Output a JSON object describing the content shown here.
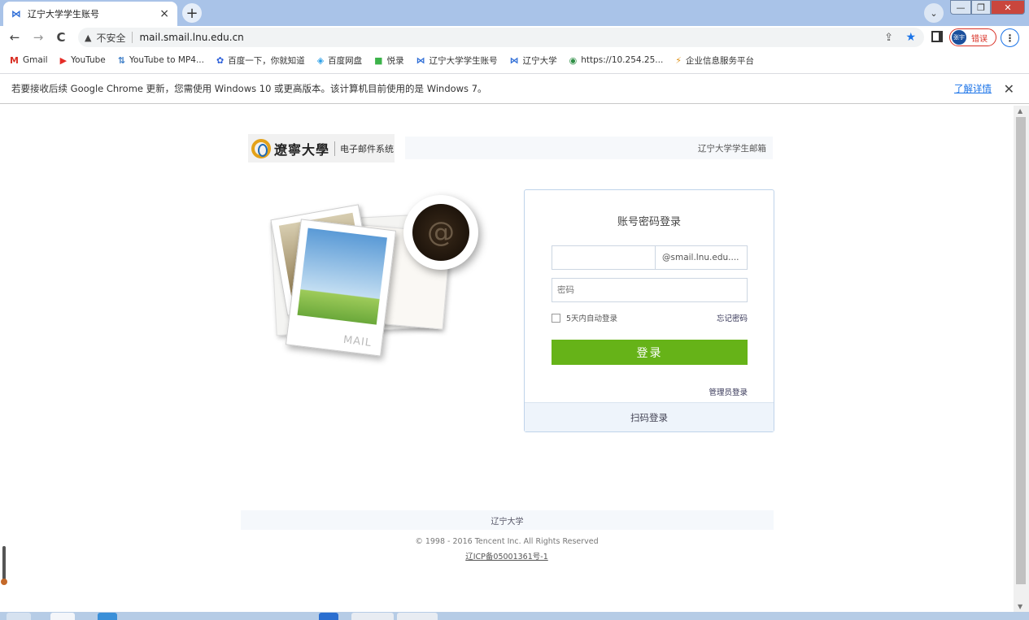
{
  "browser": {
    "tab_title": "辽宁大学学生账号",
    "tab_close": "×",
    "new_tab": "+",
    "tab_search": "⌄",
    "window_min": "—",
    "window_max": "❐",
    "window_close": "✕",
    "nav_back": "←",
    "nav_forward": "→",
    "nav_reload": "C",
    "security_label": "不安全",
    "url": "mail.smail.lnu.edu.cn",
    "profile_error": "错误",
    "profile_avatar": "张宇",
    "menu": "⋮"
  },
  "bookmarks": [
    {
      "icon": "gmail-icon",
      "glyph": "M",
      "color": "#d93025",
      "label": "Gmail"
    },
    {
      "icon": "youtube-icon",
      "glyph": "▶",
      "color": "#e52d27",
      "label": "YouTube"
    },
    {
      "icon": "convert-icon",
      "glyph": "⇅",
      "color": "#3b7cc7",
      "label": "YouTube to MP4..."
    },
    {
      "icon": "baidu-icon",
      "glyph": "✿",
      "color": "#2b5fd9",
      "label": "百度一下，你就知道"
    },
    {
      "icon": "baidu-pan-icon",
      "glyph": "◈",
      "color": "#2da0e8",
      "label": "百度网盘"
    },
    {
      "icon": "yuelu-icon",
      "glyph": "■",
      "color": "#3cb34a",
      "label": "悦录"
    },
    {
      "icon": "lnu-account-icon",
      "glyph": "⋈",
      "color": "#2b6bd6",
      "label": "辽宁大学学生账号"
    },
    {
      "icon": "lnu-icon",
      "glyph": "⋈",
      "color": "#2b6bd6",
      "label": "辽宁大学"
    },
    {
      "icon": "globe-icon",
      "glyph": "◉",
      "color": "#2f8f46",
      "label": "https://10.254.25..."
    },
    {
      "icon": "enterprise-icon",
      "glyph": "⚡",
      "color": "#e0931b",
      "label": "企业信息服务平台"
    }
  ],
  "infobar": {
    "message": "若要接收后续 Google Chrome 更新，您需使用 Windows 10 或更高版本。该计算机目前使用的是 Windows 7。",
    "learn_more": "了解详情",
    "close": "✕"
  },
  "page": {
    "logo_calligraphy": "遼寧大學",
    "logo_system": "电子邮件系统",
    "top_label": "辽宁大学学生邮箱",
    "photo_caption": "MAIL",
    "coffee_symbol": "@",
    "login": {
      "title": "账号密码登录",
      "username_value": "",
      "domain_suffix": "@smail.lnu.edu....",
      "password_placeholder": "密码",
      "remember_label": "5天内自动登录",
      "forgot_label": "忘记密码",
      "submit_label": "登录",
      "admin_label": "管理员登录",
      "qr_label": "扫码登录"
    },
    "footer_link": "辽宁大学",
    "copyright": "© 1998 - 2016 Tencent Inc. All Rights Reserved",
    "icp": "辽ICP备05001361号-1"
  },
  "colors": {
    "login_button": "#66b318",
    "tabstrip": "#a9c3e8",
    "link": "#1a73e8"
  }
}
